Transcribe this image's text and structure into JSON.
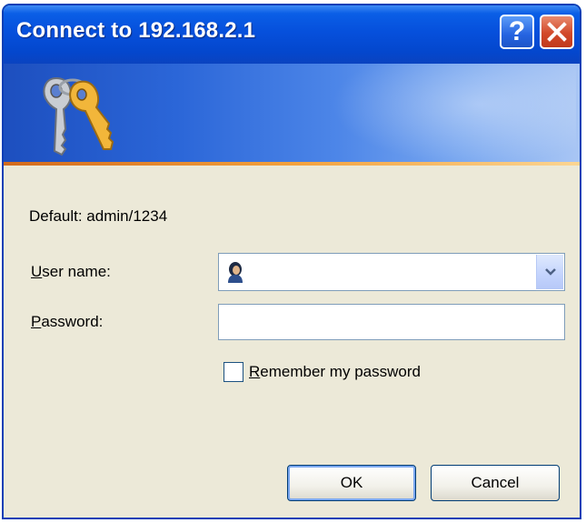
{
  "window": {
    "title": "Connect to 192.168.2.1",
    "help_label": "?",
    "close_label": "✕"
  },
  "banner": {
    "icon": "keys-icon"
  },
  "form": {
    "default_hint": "Default: admin/1234",
    "username_label_accel": "U",
    "username_label_rest": "ser name:",
    "username_value": "",
    "password_label_accel": "P",
    "password_label_rest": "assword:",
    "password_value": "",
    "remember_label_accel": "R",
    "remember_label_rest": "emember my password",
    "remember_checked": false
  },
  "buttons": {
    "ok_label": "OK",
    "cancel_label": "Cancel"
  },
  "colors": {
    "titlebar": "#0650dc",
    "dialog_bg": "#ece9d8",
    "accent_line": "#f3a13c"
  }
}
